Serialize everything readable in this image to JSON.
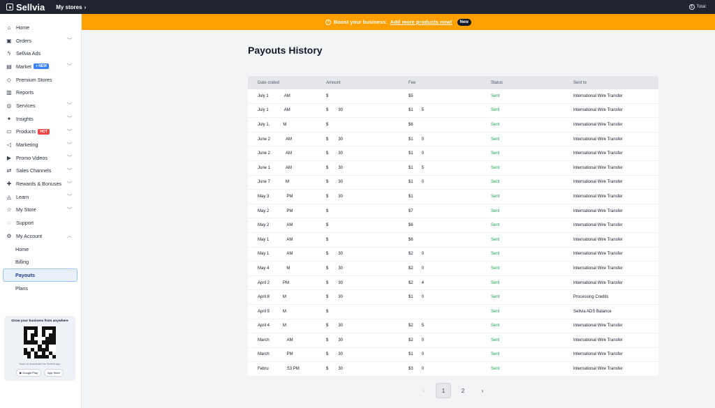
{
  "topbar": {
    "app_name": "Sellvia",
    "stores_label": "My stores",
    "total_label": "Total:"
  },
  "banner": {
    "text": "Boost your business:",
    "link": "Add more products now!",
    "pill": "New"
  },
  "sidebar": {
    "items": [
      {
        "label": "Home",
        "icon": "home-icon",
        "glyph": "⌂",
        "chev": false
      },
      {
        "label": "Orders",
        "icon": "cart-icon",
        "glyph": "▣",
        "chev": true
      },
      {
        "label": "Sellvia Ads",
        "icon": "bolt-icon",
        "glyph": "ϟ",
        "chev": false
      },
      {
        "label": "Market",
        "icon": "shop-icon",
        "glyph": "▤",
        "chev": true,
        "badge": "+ NEW",
        "badge_type": "new"
      },
      {
        "label": "Premium Stores",
        "icon": "tag-icon",
        "glyph": "◇",
        "chev": false
      },
      {
        "label": "Reports",
        "icon": "report-icon",
        "glyph": "▥",
        "chev": false
      },
      {
        "label": "Services",
        "icon": "services-icon",
        "glyph": "◎",
        "chev": true
      },
      {
        "label": "Insights",
        "icon": "bulb-icon",
        "glyph": "✦",
        "chev": true
      },
      {
        "label": "Products",
        "icon": "box-icon",
        "glyph": "▭",
        "chev": true,
        "badge": "HOT",
        "badge_type": "hot"
      },
      {
        "label": "Marketing",
        "icon": "megaphone-icon",
        "glyph": "◁",
        "chev": true
      },
      {
        "label": "Promo Videos",
        "icon": "video-icon",
        "glyph": "▶",
        "chev": true
      },
      {
        "label": "Sales Channels",
        "icon": "channels-icon",
        "glyph": "⇄",
        "chev": true
      },
      {
        "label": "Rewards & Bonuses",
        "icon": "gift-icon",
        "glyph": "✚",
        "chev": true
      },
      {
        "label": "Learn",
        "icon": "graduation-icon",
        "glyph": "◬",
        "chev": true
      },
      {
        "label": "My Store",
        "icon": "star-icon",
        "glyph": "☆",
        "chev": true
      },
      {
        "label": "Support",
        "icon": "support-icon",
        "glyph": "◌",
        "chev": false
      },
      {
        "label": "My Account",
        "icon": "gear-icon",
        "glyph": "⚙",
        "chev": true,
        "open": true
      }
    ],
    "sub_items": [
      "Home",
      "Billing",
      "Payouts",
      "Plans"
    ],
    "active_sub": "Payouts",
    "promo": {
      "title": "Grow your business from anywhere",
      "scan": "Scan to download the Sellvia app",
      "google": "Google Play",
      "apple": "App Store"
    }
  },
  "main": {
    "title": "Payouts History",
    "columns": [
      "Date crated",
      "Amount",
      "Fee",
      "Status",
      "Sent to"
    ],
    "rows": [
      {
        "date": "July 1",
        "time": "AM",
        "amount": "$",
        "amount_tail": "",
        "fee": "$5",
        "fee_tail": "",
        "status": "Sent",
        "sent_to": "International Wire Transfer"
      },
      {
        "date": "July 1",
        "time": "AM",
        "amount": "$",
        "amount_tail": "30",
        "fee": "$1",
        "fee_tail": "5",
        "status": "Sent",
        "sent_to": "International Wire Transfer"
      },
      {
        "date": "July 1,",
        "time": "M",
        "amount": "$",
        "amount_tail": "",
        "fee": "$6",
        "fee_tail": "",
        "status": "Sent",
        "sent_to": "International Wire Transfer"
      },
      {
        "date": "June 2",
        "time": "AM",
        "amount": "$",
        "amount_tail": "30",
        "fee": "$1",
        "fee_tail": "0",
        "status": "Sent",
        "sent_to": "International Wire Transfer"
      },
      {
        "date": "June 2",
        "time": "AM",
        "amount": "$",
        "amount_tail": "30",
        "fee": "$1",
        "fee_tail": "0",
        "status": "Sent",
        "sent_to": "International Wire Transfer"
      },
      {
        "date": "June 1",
        "time": "AM",
        "amount": "$",
        "amount_tail": "30",
        "fee": "$1",
        "fee_tail": "5",
        "status": "Sent",
        "sent_to": "International Wire Transfer"
      },
      {
        "date": "June 7",
        "time": "M",
        "amount": "$",
        "amount_tail": "30",
        "fee": "$1",
        "fee_tail": "0",
        "status": "Sent",
        "sent_to": "International Wire Transfer"
      },
      {
        "date": "May 3",
        "time": "PM",
        "amount": "$",
        "amount_tail": "30",
        "fee": "$1",
        "fee_tail": "",
        "status": "Sent",
        "sent_to": "International Wire Transfer"
      },
      {
        "date": "May 2",
        "time": "PM",
        "amount": "$",
        "amount_tail": "",
        "fee": "$7",
        "fee_tail": "",
        "status": "Sent",
        "sent_to": "International Wire Transfer"
      },
      {
        "date": "May 2",
        "time": "AM",
        "amount": "$",
        "amount_tail": "",
        "fee": "$6",
        "fee_tail": "",
        "status": "Sent",
        "sent_to": "International Wire Transfer"
      },
      {
        "date": "May 1",
        "time": "AM",
        "amount": "$",
        "amount_tail": "",
        "fee": "$6",
        "fee_tail": "",
        "status": "Sent",
        "sent_to": "International Wire Transfer"
      },
      {
        "date": "May 1",
        "time": "AM",
        "amount": "$",
        "amount_tail": "30",
        "fee": "$2",
        "fee_tail": "0",
        "status": "Sent",
        "sent_to": "International Wire Transfer"
      },
      {
        "date": "May 4",
        "time": "M",
        "amount": "$",
        "amount_tail": "30",
        "fee": "$2",
        "fee_tail": "0",
        "status": "Sent",
        "sent_to": "International Wire Transfer"
      },
      {
        "date": "April 2",
        "time": "PM",
        "amount": "$",
        "amount_tail": "30",
        "fee": "$2",
        "fee_tail": "4",
        "status": "Sent",
        "sent_to": "International Wire Transfer"
      },
      {
        "date": "April 8",
        "time": "M",
        "amount": "$",
        "amount_tail": "30",
        "fee": "$1",
        "fee_tail": "0",
        "status": "Sent",
        "sent_to": "Processing Credits"
      },
      {
        "date": "April 5",
        "time": "M",
        "amount": "$",
        "amount_tail": "",
        "fee": "",
        "fee_tail": "",
        "status": "Sent",
        "sent_to": "Sellvia ADS Balance"
      },
      {
        "date": "April 4",
        "time": "M",
        "amount": "$",
        "amount_tail": "30",
        "fee": "$2",
        "fee_tail": "5",
        "status": "Sent",
        "sent_to": "International Wire Transfer"
      },
      {
        "date": "March",
        "time": "AM",
        "amount": "$",
        "amount_tail": "30",
        "fee": "$2",
        "fee_tail": "0",
        "status": "Sent",
        "sent_to": "International Wire Transfer"
      },
      {
        "date": "March",
        "time": "PM",
        "amount": "$",
        "amount_tail": "30",
        "fee": "$1",
        "fee_tail": "0",
        "status": "Sent",
        "sent_to": "International Wire Transfer"
      },
      {
        "date": "Febru",
        "time": ":53 PM",
        "amount": "$",
        "amount_tail": "30",
        "fee": "$3",
        "fee_tail": "0",
        "status": "Sent",
        "sent_to": "International Wire Transfer"
      }
    ],
    "pager": {
      "prev": "‹",
      "pages": [
        "1",
        "2"
      ],
      "active": "1",
      "next": "›"
    }
  },
  "colors": {
    "topbar": "#1f2430",
    "banner": "#ff9f00",
    "sent": "#16a34a",
    "accent": "#3b82f6"
  }
}
